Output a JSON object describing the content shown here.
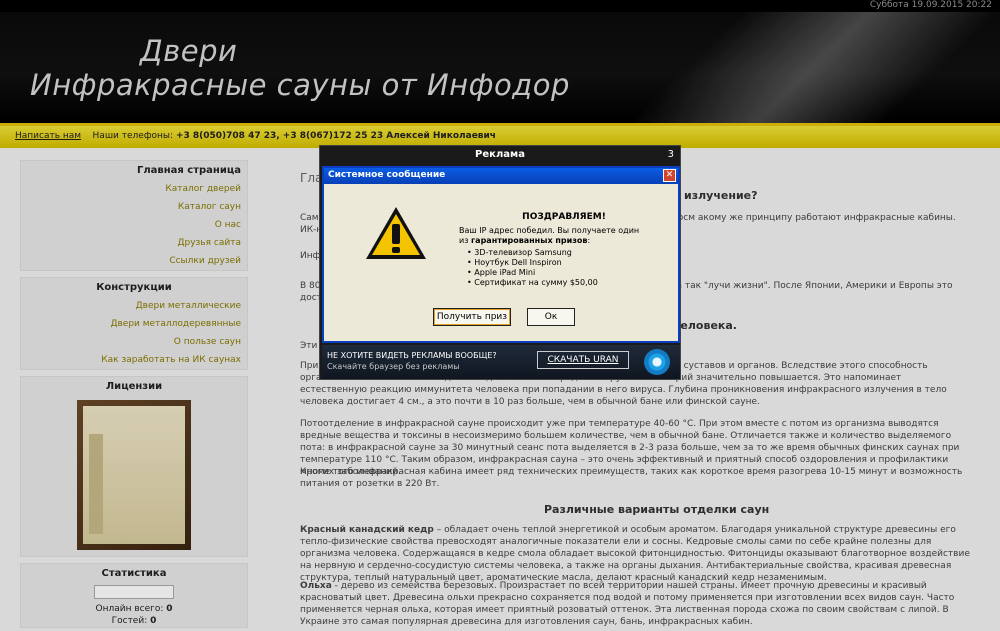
{
  "header": {
    "date": "Суббота 19.09.2015 20:22",
    "title_line1": "Двери",
    "title_line2": "Инфракрасные сауны от Инфодор"
  },
  "phonebar": {
    "write_link": "Написать нам",
    "phones_label": "Наши телефоны:",
    "phones": "+3 8(050)708 47 23, +3 8(067)172 25 23 Алексей Николаевич"
  },
  "sidebar": {
    "main_menu": {
      "title": "Главная страница",
      "items": [
        "Каталог дверей",
        "Каталог саун",
        "О нас",
        "Друзья сайта",
        "Ссылки друзей"
      ]
    },
    "constructions": {
      "title": "Конструкции",
      "items": [
        "Двери металлические",
        "Двери металлодеревянные",
        "О пользе саун",
        "Как заработать на ИК саунах"
      ]
    },
    "licenses": {
      "title": "Лицензии"
    },
    "stats": {
      "title": "Статистика",
      "online_label": "Онлайн всего:",
      "online_value": "0",
      "guests_label": "Гостей:",
      "guests_value": "0"
    }
  },
  "content": {
    "page_title": "Гла",
    "heading1": "излучение?",
    "para1": "Само                                                                                                           ому на Земле. Энергия солнечных инфракрасных лучей, проходя через косм                                                                                             акому же принципу работают инфракрасные кабины. ИК-нагреватели прои                                                                                               том помещении практически не нагревается.",
    "para2": "Инфр                                                                                                           , как обычное тепло, а позитивное воздействие тепла на человека обще",
    "para3": "В 80-                                                                                                              мерики как запатентованное средство для согревания новорожденных, а так                                                                                                     \"лучи жизни\". После Японии, Америки и Европы это достижением науч",
    "heading2": "на человека.",
    "para4": "Эти                                                                                                                ека, что доказали множество исследований и экспериментов.",
    "para5": "При                                                                                                                о 38,5 °С, что ускоряет поток крови и других жидкостей тела, повы                                                                                            мышц, суставов и органов. Вследствие этого способность организма самостоятельно подавлять деятельность вредных вирусов и бактерий значительно повышается. Это напоминает естественную реакцию иммунитета человека при попадании в него вируса. Глубина проникновения инфракрасного излучения в тело человека достигает 4 см., а это почти в 10 раз больше, чем в обычной бане или финской сауне.",
    "para6": "Потоотделение в инфракрасной сауне происходит уже при температуре 40-60 °С. При этом вместе с потом из организма выводятся вредные вещества и токсины в несоизмеримо большем количестве, чем в обычной бане. Отличается также и количество выделяемого пота: в инфракрасной сауне за 30 минутный сеанс пота выделяется в 2-3 раза больше, чем за то же время обычных финских саунах при температуре 110 °С. Таким образом, инфракрасная сауна – это очень эффективный и приятный способ оздоровления и профилактики многих заболеваний.",
    "para7": "Кроме того инфракрасная кабина имеет ряд технических преимуществ, таких как короткое время разогрева 10-15 минут и возможность питания от розетки в 220 Вт.",
    "heading3": "Различные варианты отделки саун",
    "para8_bold": "Красный канадский кедр",
    "para8": " – обладает очень теплой энергетикой и особым ароматом. Благодаря уникальной структуре древесины его тепло-физические свойства превосходят аналогичные показатели ели и сосны. Кедровые смолы сами по себе крайне полезны для организма человека. Содержащаяся в кедре смола обладает высокой фитонцидностью. Фитонциды оказывают благотворное воздействие на нервную и сердечно-сосудистую системы человека, а также на органы дыхания. Антибактериальные свойства, красивая древесная структура, теплый натуральный цвет, ароматические масла, делают красный канадский кедр незаменимым.",
    "para9_bold": "Ольха",
    "para9": " - дерево из семейства березовых. Произрастает по всей территории нашей страны. Имеет прочную древесины и красивый красноватый цвет. Древесина ольхи прекрасно сохраняется под водой и потому применяется при изготовлении всех видов саун. Часто применяется черная ольха, которая имеет приятный розоватый оттенок. Эта лиственная порода схожа по своим свойствам с липой. В Украине это самая популярная древесина для изготовления саун, бань, инфракрасных кабин."
  },
  "ad": {
    "title": "Реклама",
    "counter": "3",
    "dialog_title": "Системное сообщение",
    "close": "✕",
    "congrats": "ПОЗДРАВЛЯЕМ!",
    "line1": "Ваш IP адрес победил. Вы получаете один",
    "line2_a": "из ",
    "line2_b": "гарантированных призов",
    "line2_c": ":",
    "prizes": [
      "• 3D-телевизор Samsung",
      "• Ноутбук Dell Inspiron",
      "• Apple iPad Mini",
      "• Сертификат на сумму $50,00"
    ],
    "btn_prize": "Получить приз",
    "btn_ok": "Ок",
    "bottom_q": "НЕ ХОТИТЕ ВИДЕТЬ РЕКЛАМЫ ВООБЩЕ?",
    "bottom_s": "Скачайте браузер без рекламы",
    "download": "СКАЧАТЬ URAN"
  }
}
